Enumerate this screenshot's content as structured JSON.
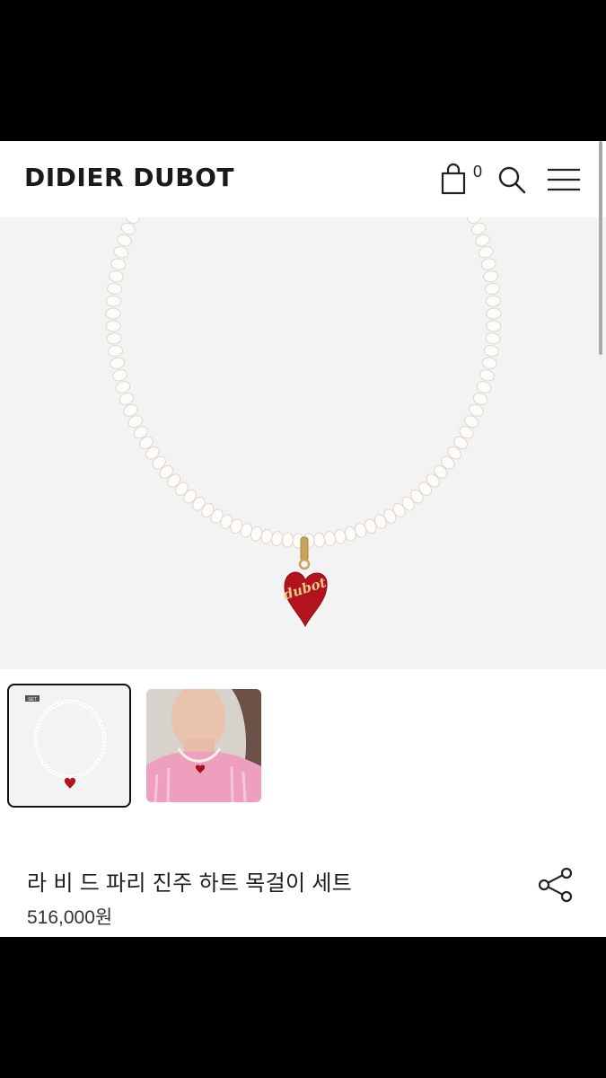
{
  "header": {
    "brand": "DIDIER DUBOT",
    "cart_count": "0",
    "icons": [
      "shopping-bag-icon",
      "search-icon",
      "hamburger-menu-icon"
    ]
  },
  "gallery": {
    "main_image": "pearl-heart-necklace",
    "pendant_engraving": "dubot",
    "thumbnails": [
      {
        "name": "necklace-product-thumbnail",
        "badge": "SET",
        "selected": true
      },
      {
        "name": "model-wearing-necklace-thumbnail",
        "selected": false
      }
    ]
  },
  "product": {
    "title": "라 비 드 파리 진주 하트 목걸이 세트",
    "price": "516,000원"
  },
  "colors": {
    "pendant_red": "#b3121f",
    "gold": "#c9a45a",
    "pearl": "#fdfcf8",
    "background": "#f3f3f3"
  }
}
